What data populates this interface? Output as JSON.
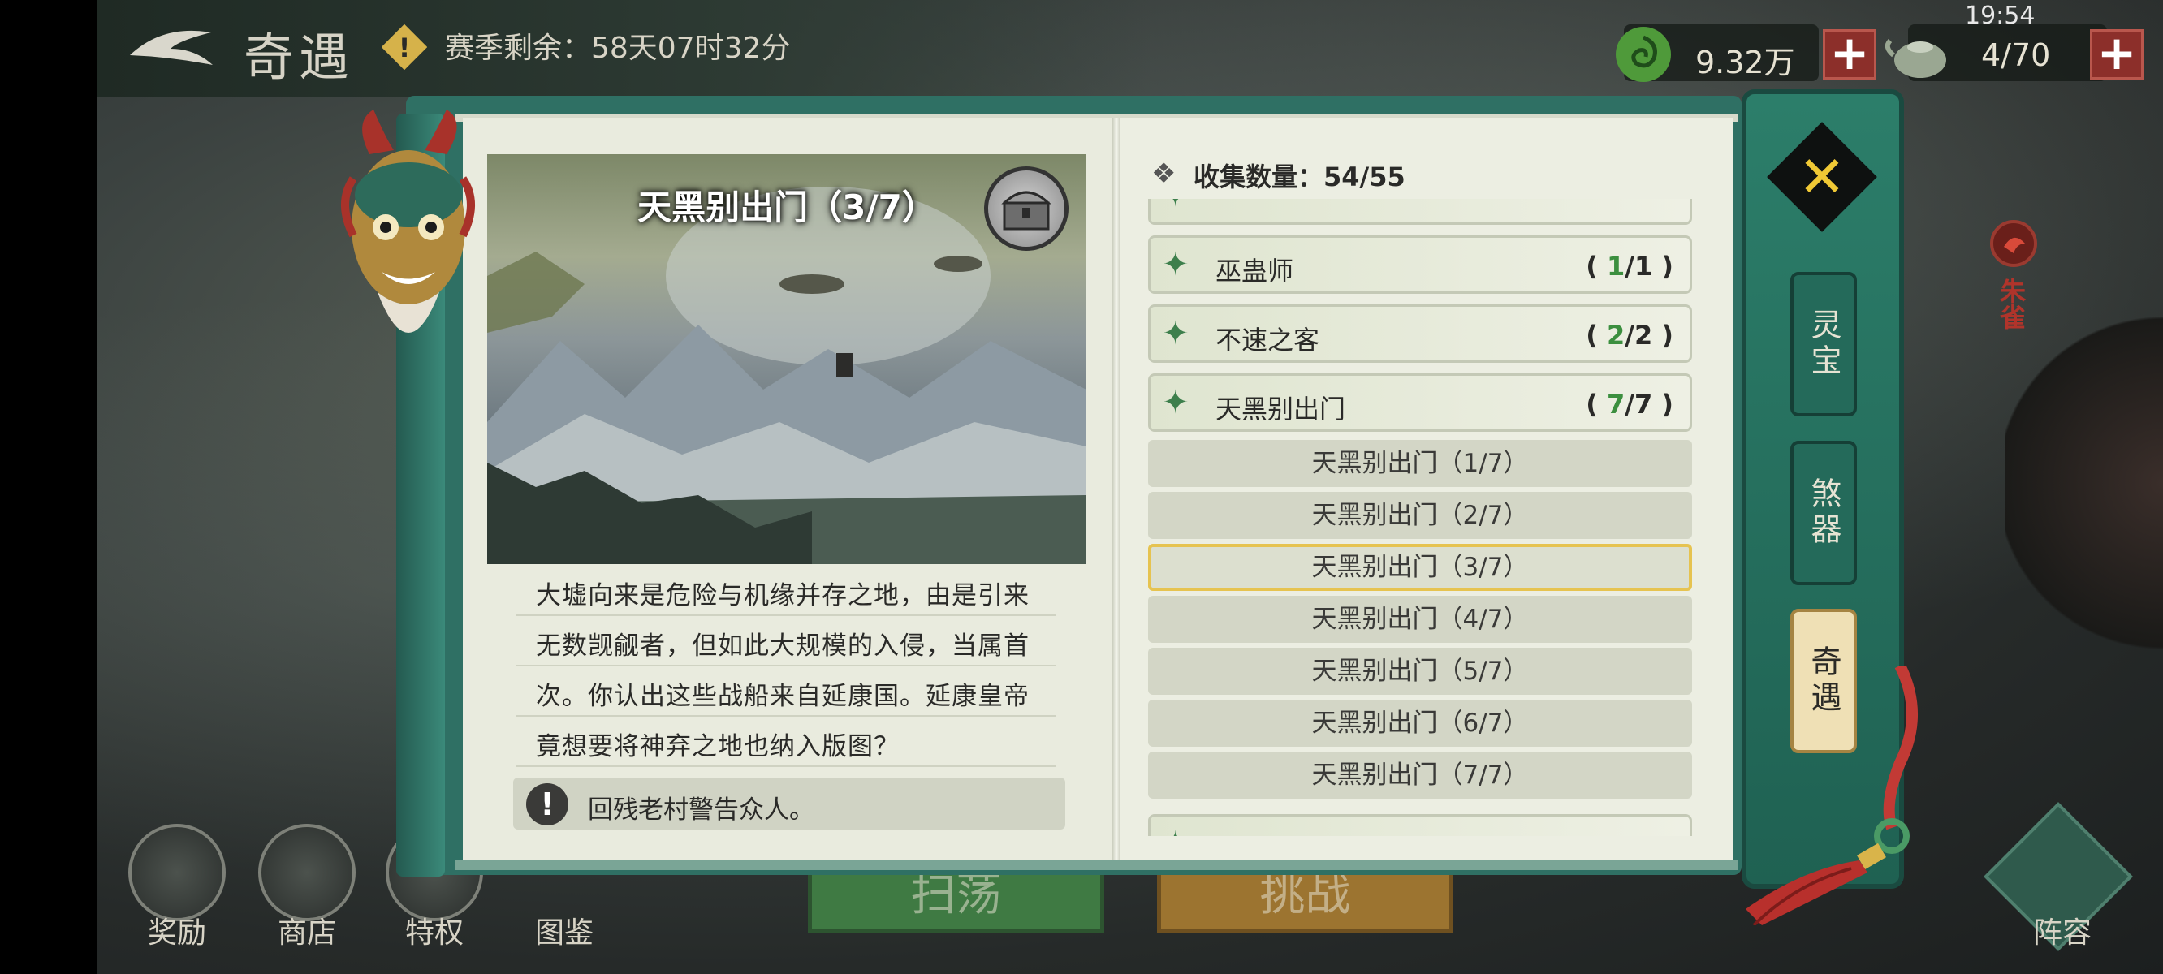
{
  "header": {
    "title": "奇遇",
    "season_text": "赛季剩余：58天07时32分",
    "clock": "19:54",
    "currency": {
      "value": "9.32万",
      "icon": "jade-coin-icon"
    },
    "stamina": {
      "value": "4/70",
      "icon": "teapot-icon"
    }
  },
  "bottom_nav": {
    "items": [
      {
        "label": "奖励",
        "icon": "gift-icon"
      },
      {
        "label": "商店",
        "icon": "shop-icon"
      },
      {
        "label": "特权",
        "icon": "privilege-icon"
      },
      {
        "label": "图鉴",
        "icon": "codex-icon"
      }
    ],
    "sweep_label": "扫荡",
    "challenge_label": "挑战",
    "lineup_label": "阵容"
  },
  "side_label": "朱雀",
  "tabs": [
    {
      "label": "灵宝",
      "active": false
    },
    {
      "label": "煞器",
      "active": false
    },
    {
      "label": "奇遇",
      "active": true
    }
  ],
  "detail": {
    "title": "天黑别出门（3/7）",
    "story_lines": [
      "大墟向来是危险与机缘并存之地，由是引来",
      "无数觊觎者，但如此大规模的入侵，当属首",
      "次。你认出这些战船来自延康国。延康皇帝",
      "竟想要将神弃之地也纳入版图？"
    ],
    "hint": "回残老村警告众人。"
  },
  "collection": {
    "label": "收集数量：54/55",
    "categories": [
      {
        "name": "巫蛊师",
        "count": "1",
        "total": "1"
      },
      {
        "name": "不速之客",
        "count": "2",
        "total": "2"
      },
      {
        "name": "天黑别出门",
        "count": "7",
        "total": "7"
      }
    ],
    "sub_items": [
      "天黑别出门（1/7）",
      "天黑别出门（2/7）",
      "天黑别出门（3/7）",
      "天黑别出门（4/7）",
      "天黑别出门（5/7）",
      "天黑别出门（6/7）",
      "天黑别出门（7/7）"
    ],
    "selected_index": 2
  },
  "colors": {
    "book_green": "#2f7064",
    "page": "#e9ebde",
    "accent_gold": "#e6c350",
    "count_green": "#3c8f3f",
    "plus_red": "#8c2f2a"
  }
}
